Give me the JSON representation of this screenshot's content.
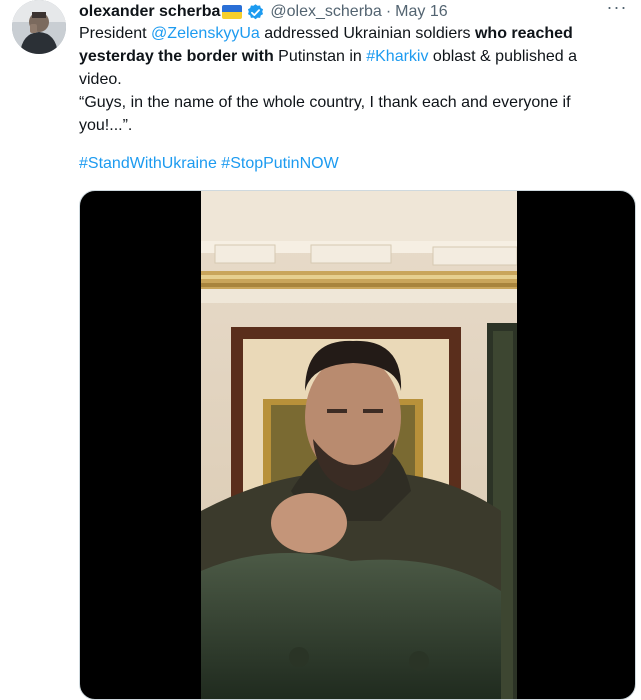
{
  "tweet": {
    "author_name": "olexander scherba",
    "handle": "@olex_scherba",
    "separator": "·",
    "date": "May 16",
    "more_label": "···",
    "text": {
      "line1_prefix": "President ",
      "mention": "@ZelenskyyUa",
      "line1_mid": " addressed Ukrainian soldiers ",
      "bold_part": "who reached yesterday the border with",
      "line2_mid": " Putinstan in ",
      "hashtag_kharkiv": "#Kharkiv",
      "line2_suffix": " oblast & published a video.",
      "quote": "“Guys, in the name of the whole country, I thank each and everyone if you!...”."
    },
    "hashtags": [
      "#StandWithUkraine",
      "#StopPutinNOW"
    ]
  },
  "icons": {
    "avatar": "avatar-photo",
    "flag": "ukraine-flag-icon",
    "verified": "verified-badge-icon",
    "more": "more-options-icon"
  },
  "colors": {
    "link": "#1d9bf0",
    "muted": "#536471",
    "text": "#0f1419",
    "verified": "#1d9bf0",
    "flag_blue": "#2a6fd6",
    "flag_yellow": "#f7cf2b"
  }
}
